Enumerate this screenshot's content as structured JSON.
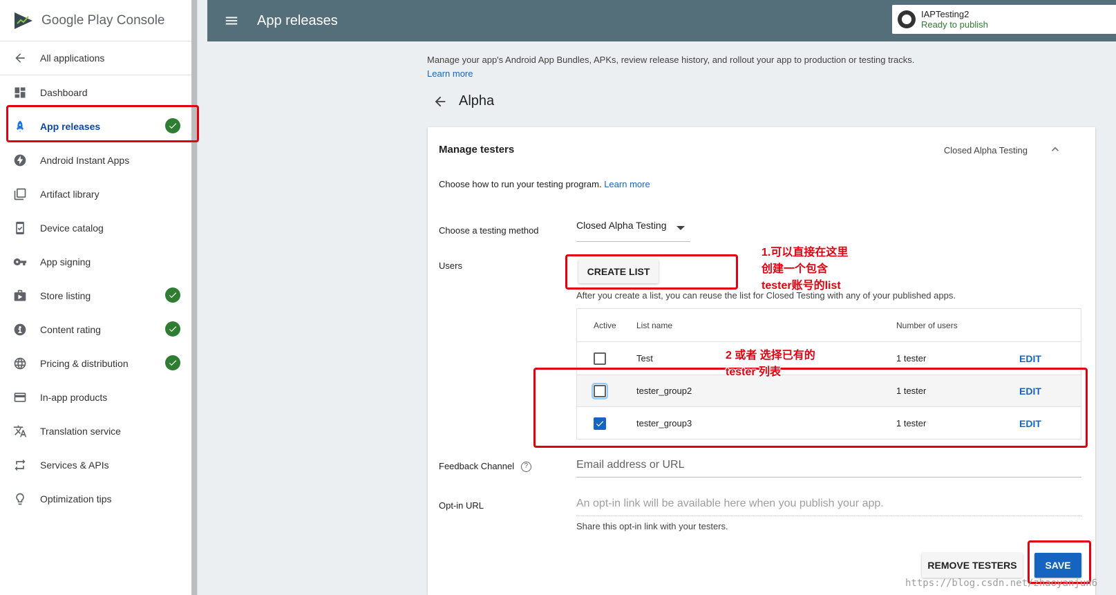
{
  "brand": {
    "logo_text": "Google Play Console"
  },
  "sidebar": {
    "items": [
      {
        "label": "All applications",
        "icon": "arrow-left-icon"
      },
      {
        "label": "Dashboard",
        "icon": "dashboard-icon"
      },
      {
        "label": "App releases",
        "icon": "rocket-icon",
        "active": true,
        "checked": true
      },
      {
        "label": "Android Instant Apps",
        "icon": "bolt-icon"
      },
      {
        "label": "Artifact library",
        "icon": "library-icon"
      },
      {
        "label": "Device catalog",
        "icon": "device-icon"
      },
      {
        "label": "App signing",
        "icon": "key-icon"
      },
      {
        "label": "Store listing",
        "icon": "store-icon",
        "checked": true
      },
      {
        "label": "Content rating",
        "icon": "rating-icon",
        "checked": true
      },
      {
        "label": "Pricing & distribution",
        "icon": "globe-icon",
        "checked": true
      },
      {
        "label": "In-app products",
        "icon": "card-icon"
      },
      {
        "label": "Translation service",
        "icon": "translate-icon"
      },
      {
        "label": "Services & APIs",
        "icon": "api-icon"
      },
      {
        "label": "Optimization tips",
        "icon": "lightbulb-icon"
      }
    ]
  },
  "header": {
    "title": "App releases"
  },
  "app_chip": {
    "name": "IAPTesting2",
    "status": "Ready to publish"
  },
  "intro": {
    "text": "Manage your app's Android App Bundles, APKs, review release history, and rollout your app to production or testing tracks.",
    "learn_more": "Learn more"
  },
  "page": {
    "title": "Alpha"
  },
  "card": {
    "title": "Manage testers",
    "subtitle": "Closed Alpha Testing",
    "desc": "Choose how to run your testing program.",
    "desc_link": "Learn more",
    "method_label": "Choose a testing method",
    "method_value": "Closed Alpha Testing",
    "users_label": "Users",
    "create_list": "CREATE LIST",
    "create_help": "After you create a list, you can reuse the list for Closed Testing with any of your published apps.",
    "table": {
      "headers": {
        "active": "Active",
        "name": "List name",
        "count": "Number of users"
      },
      "rows": [
        {
          "name": "Test",
          "count": "1 tester",
          "edit": "EDIT",
          "checked": false
        },
        {
          "name": "tester_group2",
          "count": "1 tester",
          "edit": "EDIT",
          "checked": false
        },
        {
          "name": "tester_group3",
          "count": "1 tester",
          "edit": "EDIT",
          "checked": true
        }
      ]
    },
    "feedback_label": "Feedback Channel",
    "feedback_placeholder": "Email address or URL",
    "optin_label": "Opt-in URL",
    "optin_placeholder": "An opt-in link will be available here when you publish your app.",
    "optin_help": "Share this opt-in link with your testers.",
    "remove_testers": "REMOVE TESTERS",
    "save": "SAVE"
  },
  "annotations": {
    "a1_line1": "1.可以直接在这里",
    "a1_line2": "创建一个包含",
    "a1_line3": "tester账号的list",
    "a2_line1": "2 或者 选择已有的",
    "a2_line2": "tester 列表"
  },
  "watermark": "https://blog.csdn.net/zhaoyanjun6"
}
